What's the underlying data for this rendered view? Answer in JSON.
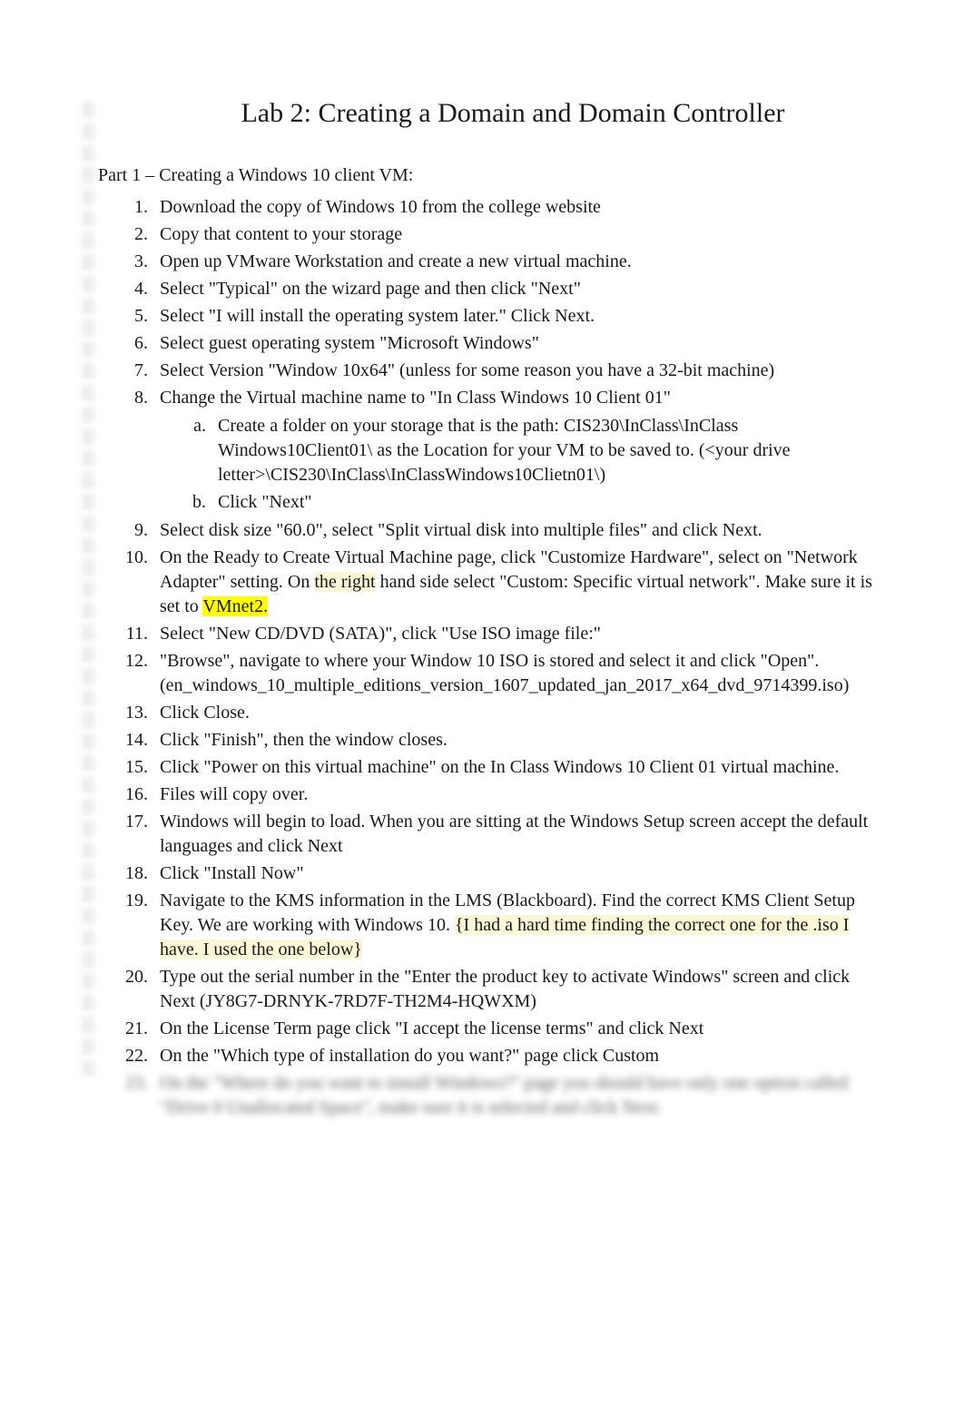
{
  "title": "Lab 2: Creating a Domain and Domain Controller",
  "section1": "Part 1 – Creating a Windows 10 client VM:",
  "steps": {
    "s1": "Download the copy of Windows 10 from the college website",
    "s2": "Copy that content to your storage",
    "s3": "Open up VMware Workstation and create a new virtual machine.",
    "s4": "Select \"Typical\" on the wizard page and then click \"Next\"",
    "s5": "Select \"I will install the operating system later.\" Click Next.",
    "s6": "Select guest operating system \"Microsoft Windows\"",
    "s7": "Select Version \"Window 10x64\" (unless for some reason you have a 32-bit machine)",
    "s8": "Change the Virtual machine name to \"In Class Windows 10 Client 01\"",
    "s8a": "Create a folder on your storage that is the path: CIS230\\InClass\\InClass Windows10Client01\\ as the Location for your VM to be saved to. (<your drive letter>\\CIS230\\InClass\\InClassWindows10Clietn01\\)",
    "s8b": "Click \"Next\"",
    "s9": "Select disk size \"60.0\", select \"Split virtual disk into multiple files\" and click Next.",
    "s10a": "On the Ready to Create Virtual Machine page, click \"Customize Hardware\", select on \"Network Adapter\" setting. On ",
    "s10b": "the right",
    "s10c": " hand side select \"Custom: Specific virtual network\". Make sure it is set to  ",
    "s10d": "VMnet2.",
    "s11": "Select \"New CD/DVD (SATA)\", click \"Use ISO image file:\"",
    "s12": "\"Browse\", navigate to where your Window 10 ISO is stored and select it and click \"Open\".",
    "s12iso": "(en_windows_10_multiple_editions_version_1607_updated_jan_2017_x64_dvd_9714399.iso)",
    "s13": "Click Close.",
    "s14": "Click \"Finish\", then the window closes.",
    "s15": "Click \"Power on this virtual machine\" on the In Class Windows 10 Client 01 virtual machine.",
    "s16": "Files will copy over.",
    "s17": "Windows will begin to load. When you are sitting at the Windows Setup screen accept the default languages and click Next",
    "s18": "Click \"Install Now\"",
    "s19a": "Navigate to the KMS information in the LMS (Blackboard). Find the correct KMS Client Setup Key.  We are working with Windows 10.  ",
    "s19b": "{I had a hard time finding the correct one for the .iso I have.  I used the one below}",
    "s20": "Type out the serial number in the \"Enter the product key to activate Windows\" screen and click Next (JY8G7-DRNYK-7RD7F-TH2M4-HQWXM)",
    "s21": "On the License Term page click \"I accept the license terms\" and click Next",
    "s22": "On the \"Which type of installation do you want?\" page click Custom",
    "s23": "On the \"Where do you want to install Windows?\" page you should have only one option called \"Drive 0 Unallocated Space\", make sure it is selected and click Next."
  }
}
